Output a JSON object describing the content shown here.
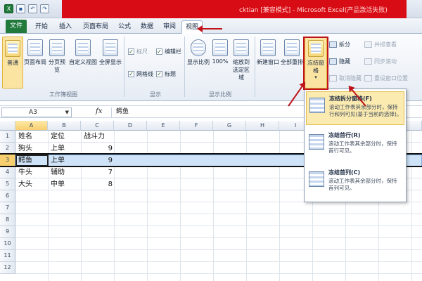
{
  "window": {
    "title": "cktian [兼容模式] - Microsoft Excel(产品激活失败)"
  },
  "quick_access": [
    "excel-logo-icon",
    "save-icon",
    "undo-icon",
    "redo-icon"
  ],
  "tabs": [
    {
      "label": "文件"
    },
    {
      "label": "开始"
    },
    {
      "label": "插入"
    },
    {
      "label": "页面布局"
    },
    {
      "label": "公式"
    },
    {
      "label": "数据"
    },
    {
      "label": "审阅"
    },
    {
      "label": "视图"
    }
  ],
  "ribbon": {
    "workbook_views": {
      "group_label": "工作簿视图",
      "buttons": [
        "普通",
        "页面布局",
        "分页预览",
        "自定义视图",
        "全屏显示"
      ]
    },
    "show": {
      "group_label": "显示",
      "checks": [
        {
          "label": "标尺",
          "checked": true
        },
        {
          "label": "编辑栏",
          "checked": true
        },
        {
          "label": "网格线",
          "checked": true
        },
        {
          "label": "标题",
          "checked": true
        }
      ]
    },
    "zoom": {
      "group_label": "显示比例",
      "buttons": [
        "显示比例",
        "100%",
        "缩放到选定区域"
      ]
    },
    "window": {
      "buttons": [
        "新建窗口",
        "全部重排",
        "冻结窗格"
      ],
      "small": [
        "拆分",
        "隐藏",
        "取消隐藏"
      ],
      "small_right": [
        "并排查看",
        "同步滚动",
        "重设窗口位置"
      ]
    }
  },
  "formula_bar": {
    "name_box": "A3",
    "fx": "fx",
    "value": "鳄鱼"
  },
  "grid": {
    "columns": [
      "A",
      "B",
      "C",
      "D",
      "E",
      "F",
      "G",
      "H",
      "I"
    ],
    "rows": [
      "1",
      "2",
      "3",
      "4",
      "5",
      "6",
      "7",
      "8",
      "9",
      "10",
      "11",
      "12"
    ],
    "data": [
      {
        "a": "姓名",
        "b": "定位",
        "c": "战斗力"
      },
      {
        "a": "狗头",
        "b": "上单",
        "c": "9"
      },
      {
        "a": "鳄鱼",
        "b": "上单",
        "c": "9"
      },
      {
        "a": "牛头",
        "b": "辅助",
        "c": "7"
      },
      {
        "a": "大头",
        "b": "中单",
        "c": "8"
      }
    ]
  },
  "freeze_menu": [
    {
      "title": "冻结拆分窗格(F)",
      "desc": "滚动工作表其余部分时，保持行和列可见(基于当前的选择)。"
    },
    {
      "title": "冻结首行(R)",
      "desc": "滚动工作表其余部分时，保持首行可见。"
    },
    {
      "title": "冻结首列(C)",
      "desc": "滚动工作表其余部分时，保持首列可见。"
    }
  ],
  "colors": {
    "accent_red": "#c0121a",
    "file_tab_green": "#217a3c",
    "highlight": "#fcebb0"
  }
}
